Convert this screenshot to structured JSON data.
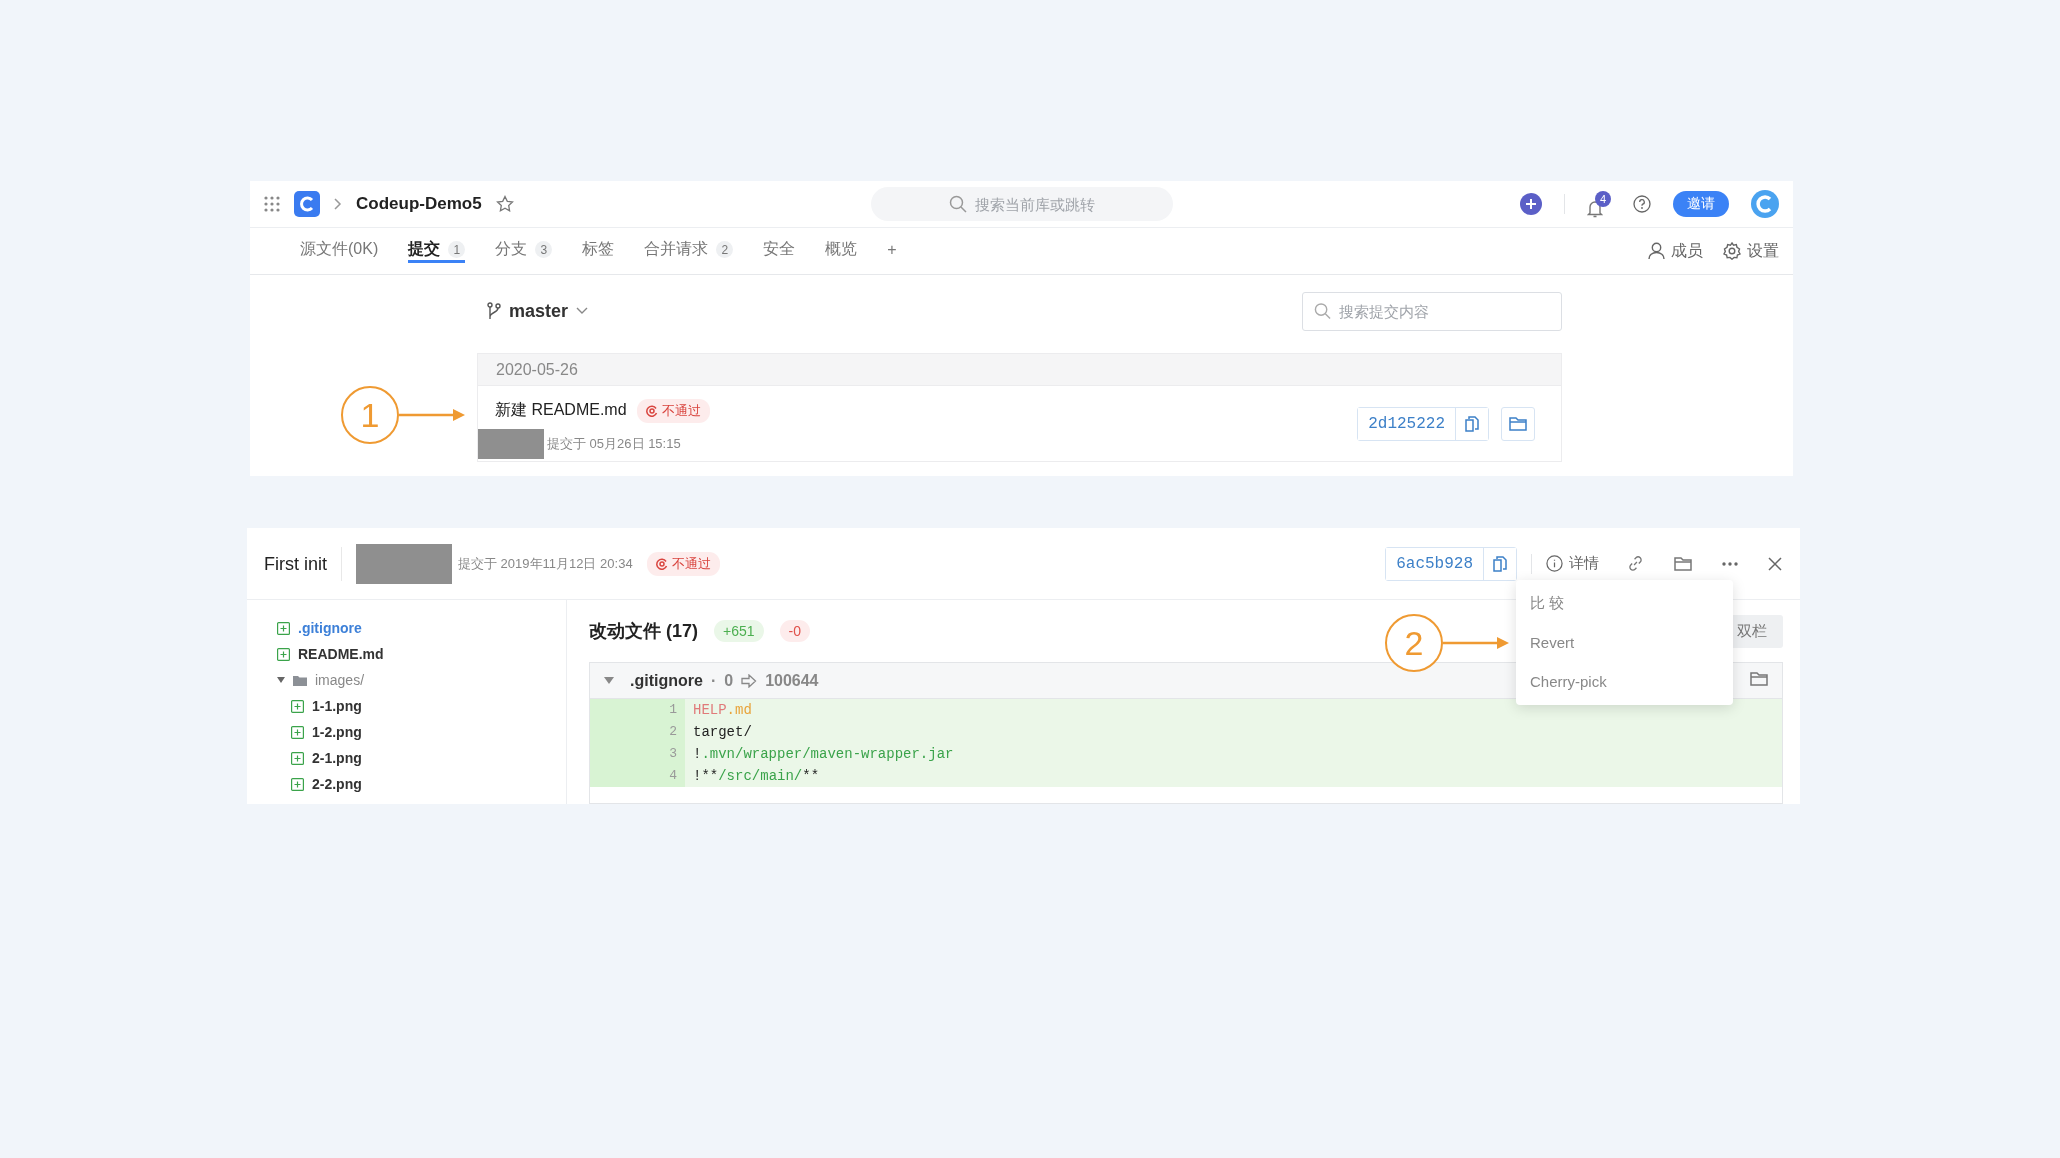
{
  "topbar": {
    "repo_name": "Codeup-Demo5",
    "search": {
      "placeholder": "搜索当前库或跳转"
    },
    "notifications": "4",
    "invite": "邀请"
  },
  "tabs": [
    {
      "label": "源文件(0K)",
      "selected": false
    },
    {
      "label": "提交",
      "count": "1",
      "selected": true
    },
    {
      "label": "分支",
      "count": "3",
      "selected": false
    },
    {
      "label": "标签",
      "selected": false
    },
    {
      "label": "合并请求",
      "count": "2",
      "selected": false
    },
    {
      "label": "安全",
      "selected": false
    },
    {
      "label": "概览",
      "selected": false
    },
    {
      "label": "+",
      "selected": false
    }
  ],
  "tab_actions": [
    {
      "kind": "members",
      "label": "成员"
    },
    {
      "kind": "settings",
      "label": "设置"
    }
  ],
  "branch": "master",
  "commit_search": {
    "placeholder": "搜索提交内容"
  },
  "commit_groups": [
    {
      "date": "2020-05-26",
      "commits": [
        {
          "title": "新建 README.md",
          "status": "不通过",
          "meta": "提交于 05月26日 15:15",
          "hash": "2d125222",
          "annotation": "1"
        }
      ]
    }
  ],
  "detail": {
    "title": "First init",
    "meta": "提交于 2019年11月12日 20:34",
    "status": "不通过",
    "hash": "6ac5b928",
    "details_label": "详情",
    "menu": {
      "items": [
        {
          "label": "比 较"
        },
        {
          "label": "Revert",
          "annotation": "2"
        },
        {
          "label": "Cherry-pick"
        }
      ]
    },
    "tree": [
      {
        "name": ".gitignore",
        "kind": "file",
        "selected": true
      },
      {
        "name": "README.md",
        "kind": "file",
        "selected": false
      },
      {
        "name": "images/",
        "kind": "folder",
        "expanded": true,
        "children": [
          {
            "name": "1-1.png",
            "kind": "file",
            "selected": false
          },
          {
            "name": "1-2.png",
            "kind": "file",
            "selected": false
          },
          {
            "name": "2-1.png",
            "kind": "file",
            "selected": false
          },
          {
            "name": "2-2.png",
            "kind": "file",
            "selected": false
          }
        ]
      }
    ],
    "changes": {
      "title": "改动文件 (17)",
      "added": "+651",
      "removed": "-0",
      "view_toggle": "双栏"
    },
    "diff": {
      "file": ".gitignore",
      "separator": "·",
      "old_mode": "0",
      "new_mode": "100644",
      "expanded": true,
      "lines": [
        {
          "number": "1",
          "tokens": [
            {
              "text": "HELP",
              "kind": "tag"
            },
            {
              "text": ".md",
              "kind": "attr"
            }
          ]
        },
        {
          "number": "2",
          "tokens": [
            {
              "text": "target/",
              "kind": "plain"
            }
          ]
        },
        {
          "number": "3",
          "tokens": [
            {
              "text": "!",
              "kind": "plain"
            },
            {
              "text": ".mvn/wrapper/maven-wrapper.jar",
              "kind": "path"
            }
          ]
        },
        {
          "number": "4",
          "tokens": [
            {
              "text": "!**",
              "kind": "plain"
            },
            {
              "text": "/src/main/",
              "kind": "path"
            },
            {
              "text": "**",
              "kind": "plain"
            }
          ]
        }
      ]
    }
  }
}
